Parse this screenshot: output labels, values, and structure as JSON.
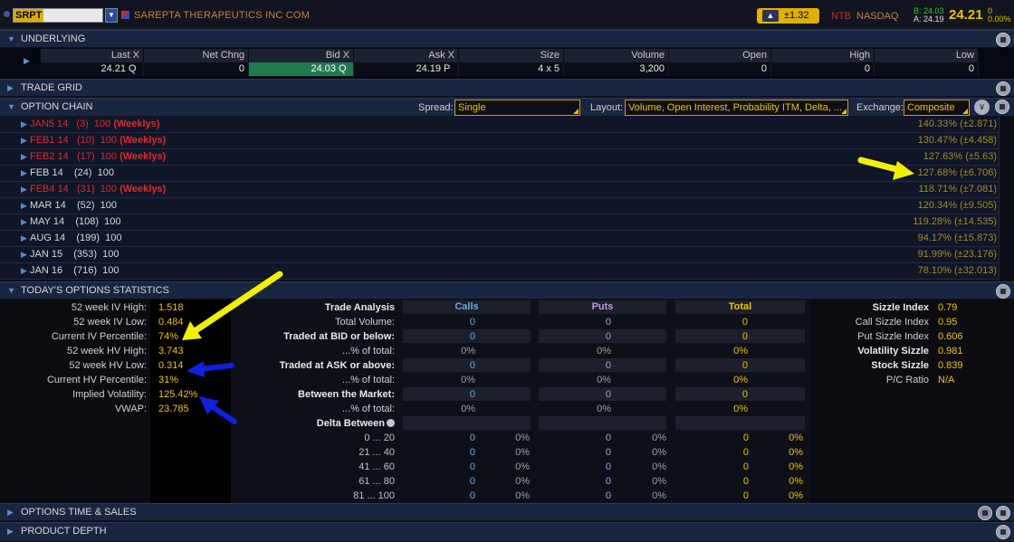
{
  "header": {
    "symbol": "SRPT",
    "company": "SAREPTA THERAPEUTICS INC COM",
    "change": "±1.32",
    "ntb": "NTB",
    "exchange": "NASDAQ",
    "bid_line": "B: 24.03",
    "ask_line": "A: 24.19",
    "last": "24.21",
    "net_change": "0",
    "pct_change": "0.00%"
  },
  "sections": {
    "underlying": "UNDERLYING",
    "trade_grid": "TRADE GRID",
    "option_chain": "OPTION CHAIN",
    "stats": "TODAY'S OPTIONS STATISTICS",
    "time_sales": "OPTIONS TIME & SALES",
    "product_depth": "PRODUCT DEPTH"
  },
  "underlying": {
    "columns": [
      "Last X",
      "Net Chng",
      "Bid X",
      "Ask X",
      "Size",
      "Volume",
      "Open",
      "High",
      "Low"
    ],
    "last": "24.21",
    "last_ex": "Q",
    "net_chng": "0",
    "bid": "24.03",
    "bid_ex": "Q",
    "ask": "24.19",
    "ask_ex": "P",
    "size": "4 x 5",
    "volume": "3,200",
    "open": "0",
    "high": "0",
    "low": "0"
  },
  "chain_controls": {
    "spread_label": "Spread:",
    "spread_value": "Single",
    "layout_label": "Layout:",
    "layout_value": "Volume, Open Interest, Probability ITM, Delta, ...",
    "exchange_label": "Exchange:",
    "exchange_value": "Composite"
  },
  "chain_rows": [
    {
      "label": "JAN5 14   (3)  100 ",
      "weekly": "(Weeklys)",
      "iv": "140.33% (±2.871)",
      "red": true
    },
    {
      "label": "FEB1 14   (10)  100 ",
      "weekly": "(Weeklys)",
      "iv": "130.47% (±4.458)",
      "red": true
    },
    {
      "label": "FEB2 14   (17)  100 ",
      "weekly": "(Weeklys)",
      "iv": "127.63% (±5.63)",
      "red": true
    },
    {
      "label": "FEB 14    (24)  100",
      "weekly": "",
      "iv": "127.68% (±6.706)",
      "red": false
    },
    {
      "label": "FEB4 14   (31)  100 ",
      "weekly": "(Weeklys)",
      "iv": "118.71% (±7.081)",
      "red": true
    },
    {
      "label": "MAR 14    (52)  100",
      "weekly": "",
      "iv": "120.34% (±9.505)",
      "red": false
    },
    {
      "label": "MAY 14    (108)  100",
      "weekly": "",
      "iv": "119.28% (±14.535)",
      "red": false
    },
    {
      "label": "AUG 14    (199)  100",
      "weekly": "",
      "iv": "94.17% (±15.873)",
      "red": false
    },
    {
      "label": "JAN 15    (353)  100",
      "weekly": "",
      "iv": "91.99% (±23.176)",
      "red": false
    },
    {
      "label": "JAN 16    (716)  100",
      "weekly": "",
      "iv": "78.10% (±32.013)",
      "red": false
    }
  ],
  "vol_stats": [
    {
      "label": "52 week IV High:",
      "value": "1.518"
    },
    {
      "label": "52 week IV Low:",
      "value": "0.484"
    },
    {
      "label": "Current IV Percentile:",
      "value": "74%"
    },
    {
      "label": "52 week HV High:",
      "value": "3.743"
    },
    {
      "label": "52 week HV Low:",
      "value": "0.314"
    },
    {
      "label": "Current HV Percentile:",
      "value": "31%"
    },
    {
      "label": "Implied Volatility:",
      "value": "125.42%"
    },
    {
      "label": "VWAP:",
      "value": "23.785"
    }
  ],
  "analysis": {
    "title": "Trade Analysis",
    "calls": "Calls",
    "puts": "Puts",
    "total": "Total",
    "rows": [
      {
        "label": "Total Volume:",
        "bold": false,
        "calls": "0",
        "puts": "0",
        "total": "0",
        "cell": false
      },
      {
        "label": "Traded at BID or below:",
        "bold": true,
        "calls": "0",
        "puts": "0",
        "total": "0",
        "cell": true
      },
      {
        "label": "...% of total:",
        "bold": false,
        "calls": "0%",
        "puts": "0%",
        "total": "0%",
        "cell": false
      },
      {
        "label": "Traded at ASK or above:",
        "bold": true,
        "calls": "0",
        "puts": "0",
        "total": "0",
        "cell": true
      },
      {
        "label": "...% of total:",
        "bold": false,
        "calls": "0%",
        "puts": "0%",
        "total": "0%",
        "cell": false
      },
      {
        "label": "Between the Market:",
        "bold": true,
        "calls": "0",
        "puts": "0",
        "total": "0",
        "cell": true
      },
      {
        "label": "...% of total:",
        "bold": false,
        "calls": "0%",
        "puts": "0%",
        "total": "0%",
        "cell": false
      }
    ],
    "delta_label": "Delta Between",
    "delta_rows": [
      {
        "range": "0 ... 20",
        "calls": "0",
        "calls_pct": "0%",
        "puts": "0",
        "puts_pct": "0%",
        "total": "0",
        "total_pct": "0%"
      },
      {
        "range": "21 ... 40",
        "calls": "0",
        "calls_pct": "0%",
        "puts": "0",
        "puts_pct": "0%",
        "total": "0",
        "total_pct": "0%"
      },
      {
        "range": "41 ... 60",
        "calls": "0",
        "calls_pct": "0%",
        "puts": "0",
        "puts_pct": "0%",
        "total": "0",
        "total_pct": "0%"
      },
      {
        "range": "61 ... 80",
        "calls": "0",
        "calls_pct": "0%",
        "puts": "0",
        "puts_pct": "0%",
        "total": "0",
        "total_pct": "0%"
      },
      {
        "range": "81 ... 100",
        "calls": "0",
        "calls_pct": "0%",
        "puts": "0",
        "puts_pct": "0%",
        "total": "0",
        "total_pct": "0%"
      }
    ]
  },
  "sizzle": [
    {
      "label": "Sizzle Index",
      "value": "0.79",
      "bold": true
    },
    {
      "label": "Call Sizzle Index",
      "value": "0.95",
      "bold": false
    },
    {
      "label": "Put Sizzle Index",
      "value": "0.606",
      "bold": false
    },
    {
      "label": "Volatility Sizzle",
      "value": "0.981",
      "bold": true
    },
    {
      "label": "Stock Sizzle",
      "value": "0.839",
      "bold": true
    },
    {
      "label": "P/C Ratio",
      "value": "N/A",
      "bold": false
    }
  ],
  "icons": {
    "section_toggle": "triangle-down-icon",
    "expand": "triangle-right-icon",
    "settings": "gear-icon",
    "filter": "funnel-icon",
    "chevron": "chevron-down-icon",
    "annotation_yellow": "#f0f000",
    "annotation_blue": "#1020e0"
  }
}
